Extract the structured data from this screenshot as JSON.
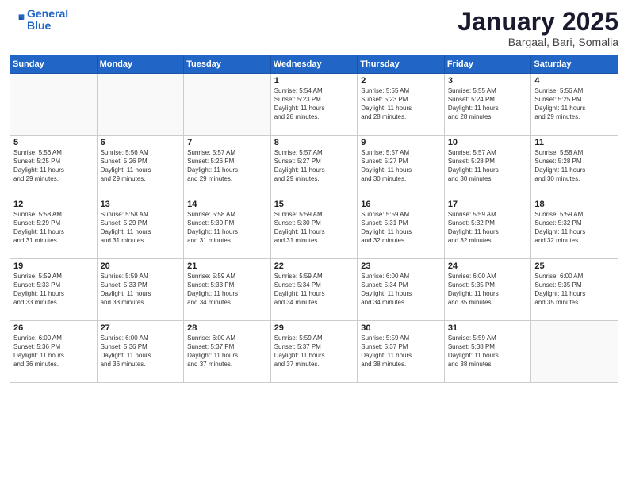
{
  "logo": {
    "line1": "General",
    "line2": "Blue"
  },
  "header": {
    "title": "January 2025",
    "subtitle": "Bargaal, Bari, Somalia"
  },
  "weekdays": [
    "Sunday",
    "Monday",
    "Tuesday",
    "Wednesday",
    "Thursday",
    "Friday",
    "Saturday"
  ],
  "weeks": [
    [
      {
        "day": "",
        "info": ""
      },
      {
        "day": "",
        "info": ""
      },
      {
        "day": "",
        "info": ""
      },
      {
        "day": "1",
        "info": "Sunrise: 5:54 AM\nSunset: 5:23 PM\nDaylight: 11 hours\nand 28 minutes."
      },
      {
        "day": "2",
        "info": "Sunrise: 5:55 AM\nSunset: 5:23 PM\nDaylight: 11 hours\nand 28 minutes."
      },
      {
        "day": "3",
        "info": "Sunrise: 5:55 AM\nSunset: 5:24 PM\nDaylight: 11 hours\nand 28 minutes."
      },
      {
        "day": "4",
        "info": "Sunrise: 5:56 AM\nSunset: 5:25 PM\nDaylight: 11 hours\nand 29 minutes."
      }
    ],
    [
      {
        "day": "5",
        "info": "Sunrise: 5:56 AM\nSunset: 5:25 PM\nDaylight: 11 hours\nand 29 minutes."
      },
      {
        "day": "6",
        "info": "Sunrise: 5:56 AM\nSunset: 5:26 PM\nDaylight: 11 hours\nand 29 minutes."
      },
      {
        "day": "7",
        "info": "Sunrise: 5:57 AM\nSunset: 5:26 PM\nDaylight: 11 hours\nand 29 minutes."
      },
      {
        "day": "8",
        "info": "Sunrise: 5:57 AM\nSunset: 5:27 PM\nDaylight: 11 hours\nand 29 minutes."
      },
      {
        "day": "9",
        "info": "Sunrise: 5:57 AM\nSunset: 5:27 PM\nDaylight: 11 hours\nand 30 minutes."
      },
      {
        "day": "10",
        "info": "Sunrise: 5:57 AM\nSunset: 5:28 PM\nDaylight: 11 hours\nand 30 minutes."
      },
      {
        "day": "11",
        "info": "Sunrise: 5:58 AM\nSunset: 5:28 PM\nDaylight: 11 hours\nand 30 minutes."
      }
    ],
    [
      {
        "day": "12",
        "info": "Sunrise: 5:58 AM\nSunset: 5:29 PM\nDaylight: 11 hours\nand 31 minutes."
      },
      {
        "day": "13",
        "info": "Sunrise: 5:58 AM\nSunset: 5:29 PM\nDaylight: 11 hours\nand 31 minutes."
      },
      {
        "day": "14",
        "info": "Sunrise: 5:58 AM\nSunset: 5:30 PM\nDaylight: 11 hours\nand 31 minutes."
      },
      {
        "day": "15",
        "info": "Sunrise: 5:59 AM\nSunset: 5:30 PM\nDaylight: 11 hours\nand 31 minutes."
      },
      {
        "day": "16",
        "info": "Sunrise: 5:59 AM\nSunset: 5:31 PM\nDaylight: 11 hours\nand 32 minutes."
      },
      {
        "day": "17",
        "info": "Sunrise: 5:59 AM\nSunset: 5:32 PM\nDaylight: 11 hours\nand 32 minutes."
      },
      {
        "day": "18",
        "info": "Sunrise: 5:59 AM\nSunset: 5:32 PM\nDaylight: 11 hours\nand 32 minutes."
      }
    ],
    [
      {
        "day": "19",
        "info": "Sunrise: 5:59 AM\nSunset: 5:33 PM\nDaylight: 11 hours\nand 33 minutes."
      },
      {
        "day": "20",
        "info": "Sunrise: 5:59 AM\nSunset: 5:33 PM\nDaylight: 11 hours\nand 33 minutes."
      },
      {
        "day": "21",
        "info": "Sunrise: 5:59 AM\nSunset: 5:33 PM\nDaylight: 11 hours\nand 34 minutes."
      },
      {
        "day": "22",
        "info": "Sunrise: 5:59 AM\nSunset: 5:34 PM\nDaylight: 11 hours\nand 34 minutes."
      },
      {
        "day": "23",
        "info": "Sunrise: 6:00 AM\nSunset: 5:34 PM\nDaylight: 11 hours\nand 34 minutes."
      },
      {
        "day": "24",
        "info": "Sunrise: 6:00 AM\nSunset: 5:35 PM\nDaylight: 11 hours\nand 35 minutes."
      },
      {
        "day": "25",
        "info": "Sunrise: 6:00 AM\nSunset: 5:35 PM\nDaylight: 11 hours\nand 35 minutes."
      }
    ],
    [
      {
        "day": "26",
        "info": "Sunrise: 6:00 AM\nSunset: 5:36 PM\nDaylight: 11 hours\nand 36 minutes."
      },
      {
        "day": "27",
        "info": "Sunrise: 6:00 AM\nSunset: 5:36 PM\nDaylight: 11 hours\nand 36 minutes."
      },
      {
        "day": "28",
        "info": "Sunrise: 6:00 AM\nSunset: 5:37 PM\nDaylight: 11 hours\nand 37 minutes."
      },
      {
        "day": "29",
        "info": "Sunrise: 5:59 AM\nSunset: 5:37 PM\nDaylight: 11 hours\nand 37 minutes."
      },
      {
        "day": "30",
        "info": "Sunrise: 5:59 AM\nSunset: 5:37 PM\nDaylight: 11 hours\nand 38 minutes."
      },
      {
        "day": "31",
        "info": "Sunrise: 5:59 AM\nSunset: 5:38 PM\nDaylight: 11 hours\nand 38 minutes."
      },
      {
        "day": "",
        "info": ""
      }
    ]
  ]
}
